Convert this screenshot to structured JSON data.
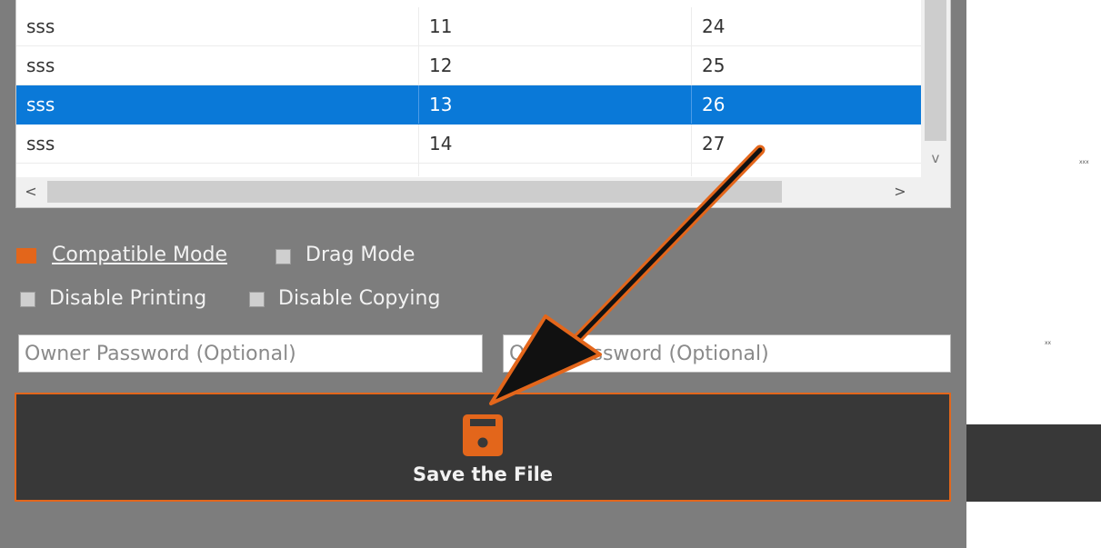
{
  "table": {
    "rows": [
      {
        "c1": "sss",
        "c2": "11",
        "c3": "24",
        "selected": false
      },
      {
        "c1": "sss",
        "c2": "12",
        "c3": "25",
        "selected": false
      },
      {
        "c1": "sss",
        "c2": "13",
        "c3": "26",
        "selected": true
      },
      {
        "c1": "sss",
        "c2": "14",
        "c3": "27",
        "selected": false
      }
    ],
    "scroll_left": "<",
    "scroll_right": ">",
    "scroll_down": "v"
  },
  "options": {
    "compatible_mode": {
      "label": "Compatible Mode",
      "checked": true
    },
    "drag_mode": {
      "label": "Drag Mode",
      "checked": false
    },
    "disable_printing": {
      "label": "Disable Printing",
      "checked": false
    },
    "disable_copying": {
      "label": "Disable Copying",
      "checked": false
    }
  },
  "passwords": {
    "owner_placeholder": "Owner Password (Optional)",
    "open_placeholder": "Open Password (Optional)"
  },
  "save": {
    "label": "Save the File",
    "icon": "floppy-disk-icon"
  },
  "colors": {
    "accent": "#e3661b",
    "selection": "#0a79d8",
    "panel": "#7d7d7d",
    "button_bg": "#383838"
  },
  "annotation": {
    "arrow_color": "#e3661b",
    "arrow_icon": "pointer-arrow-annotation"
  },
  "side": {
    "tiny_text_1": "xxx",
    "tiny_text_2": "xx"
  }
}
